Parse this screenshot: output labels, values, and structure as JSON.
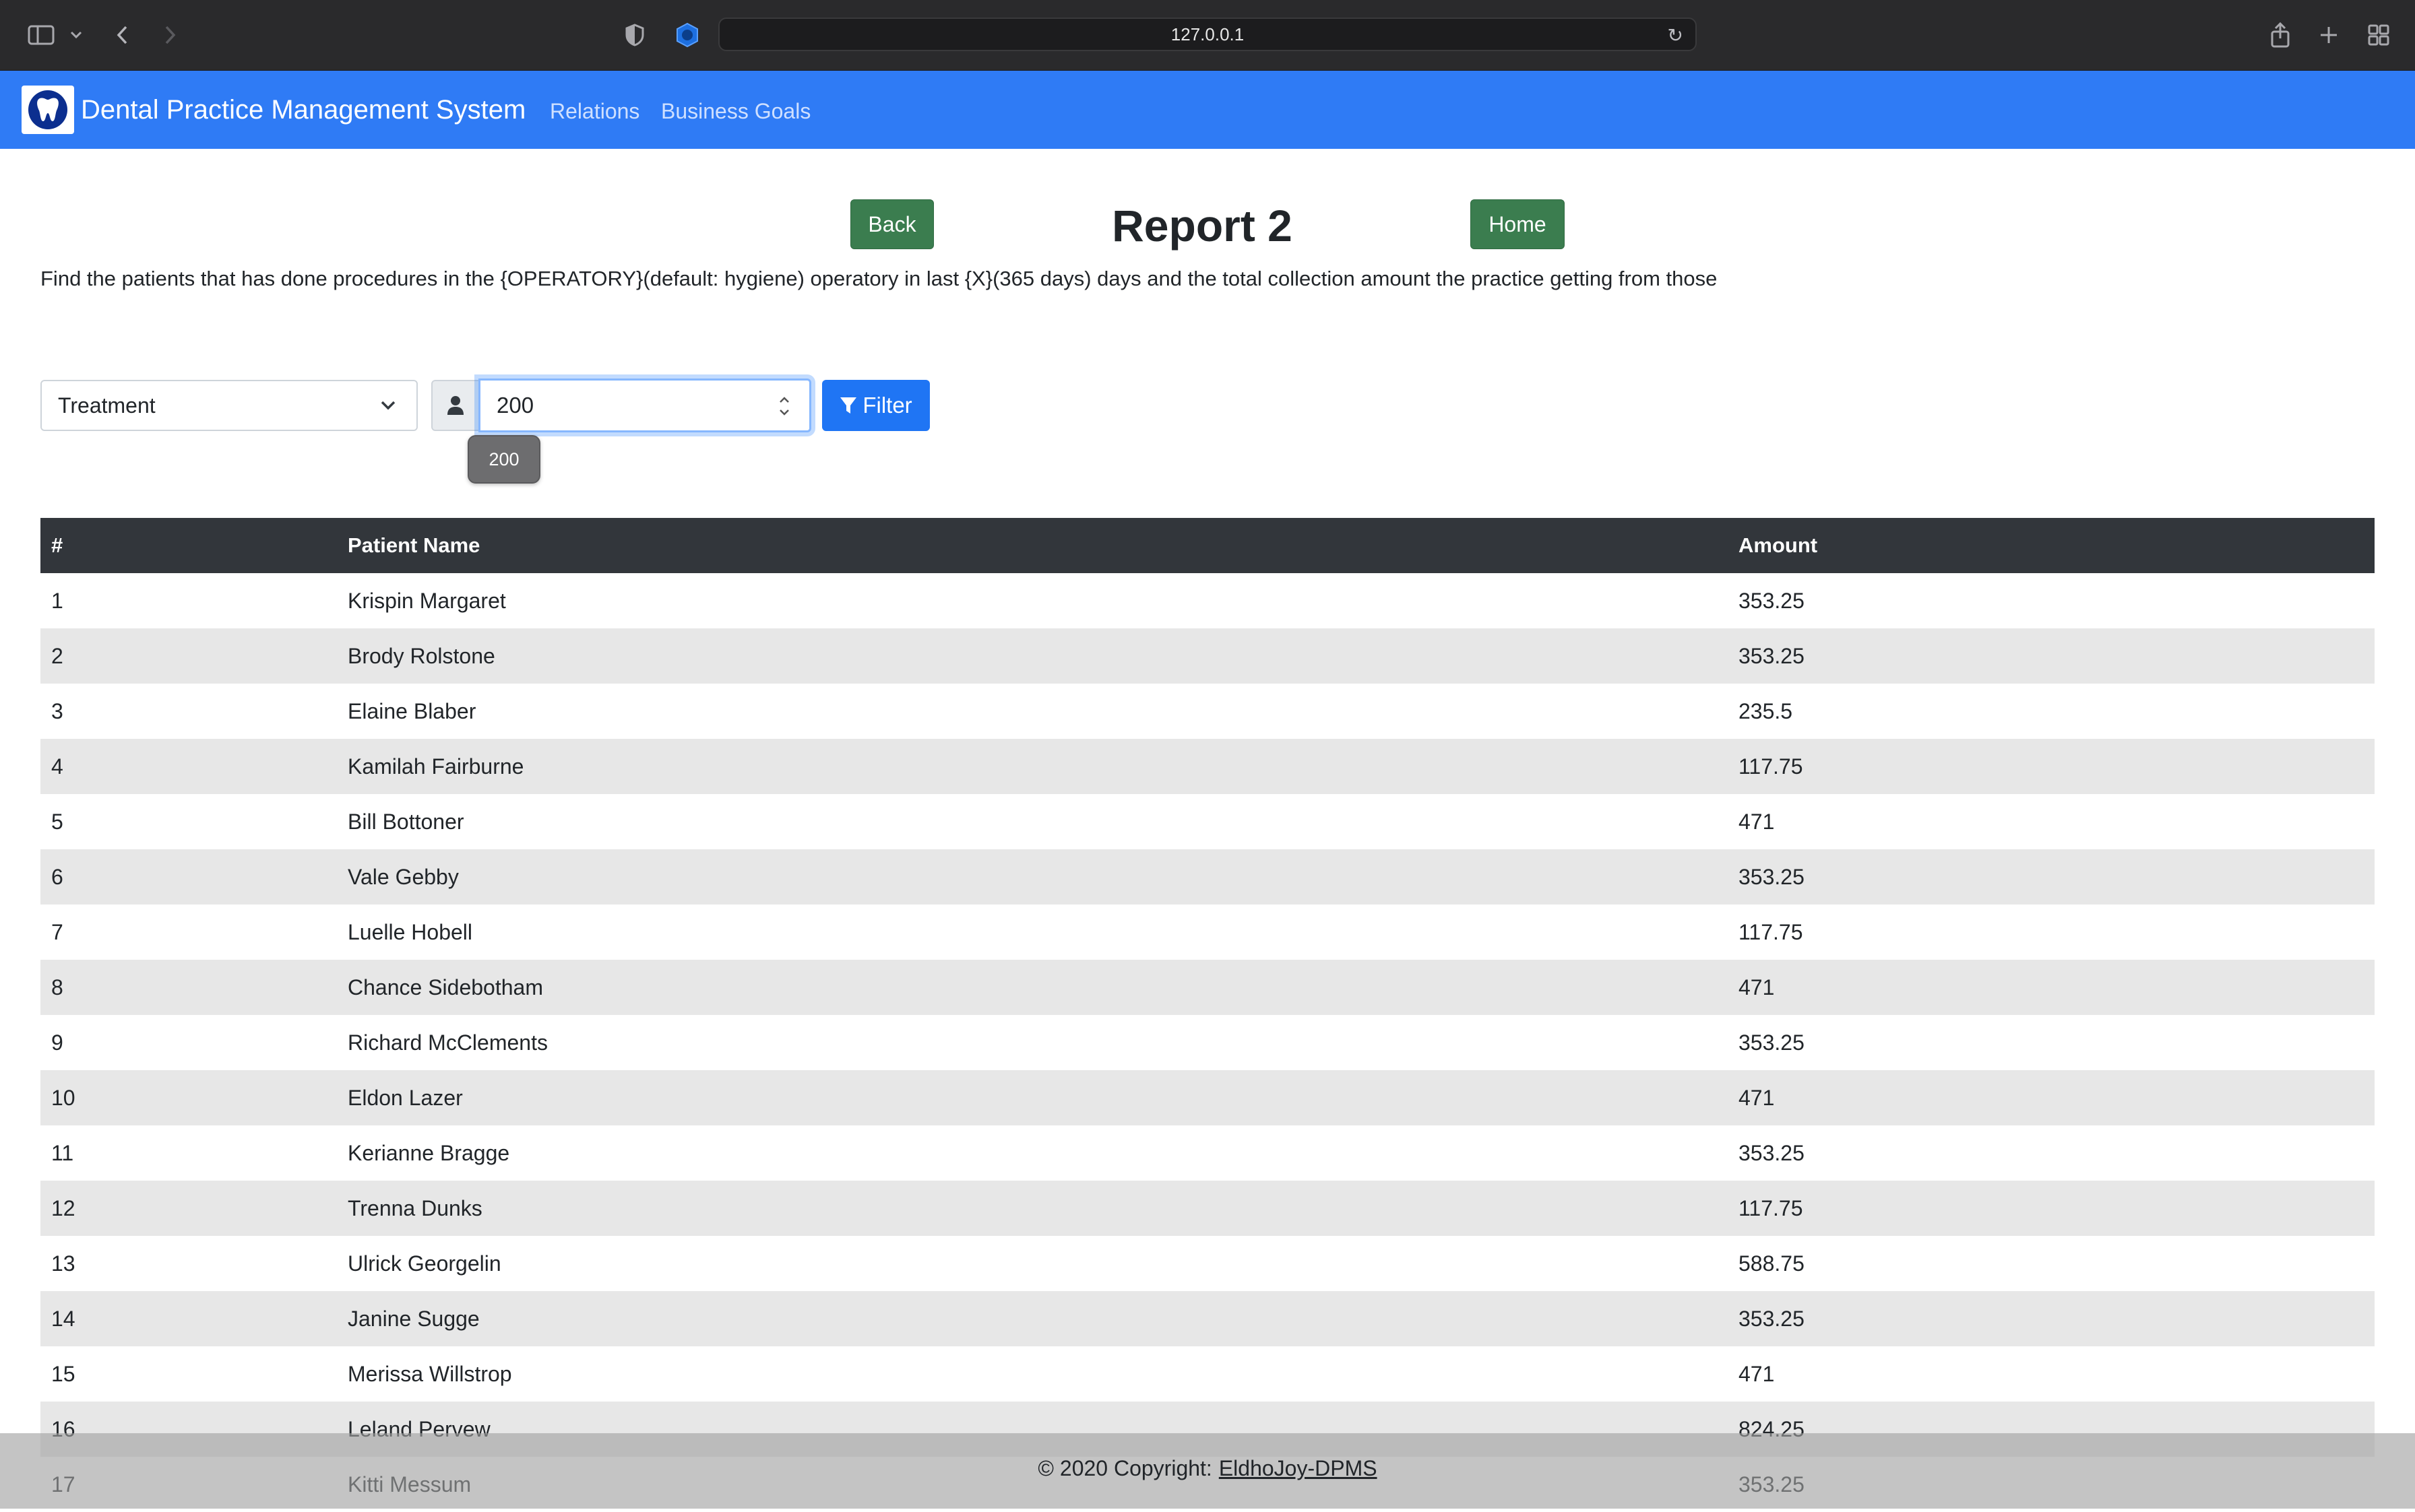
{
  "browser": {
    "url": "127.0.0.1"
  },
  "navbar": {
    "brand": "Dental Practice Management System",
    "links": [
      "Relations",
      "Business Goals"
    ]
  },
  "header": {
    "back_label": "Back",
    "title": "Report 2",
    "home_label": "Home",
    "description": "Find the patients that has done procedures in the {OPERATORY}(default: hygiene) operatory in last {X}(365 days) days and the total collection amount the practice getting from those"
  },
  "filter": {
    "select_value": "Treatment",
    "input_value": "200",
    "tooltip": "200",
    "button_label": "Filter"
  },
  "table": {
    "headers": [
      "#",
      "Patient Name",
      "Amount"
    ],
    "rows": [
      [
        "1",
        "Krispin Margaret",
        "353.25"
      ],
      [
        "2",
        "Brody Rolstone",
        "353.25"
      ],
      [
        "3",
        "Elaine Blaber",
        "235.5"
      ],
      [
        "4",
        "Kamilah Fairburne",
        "117.75"
      ],
      [
        "5",
        "Bill Bottoner",
        "471"
      ],
      [
        "6",
        "Vale Gebby",
        "353.25"
      ],
      [
        "7",
        "Luelle Hobell",
        "117.75"
      ],
      [
        "8",
        "Chance Sidebotham",
        "471"
      ],
      [
        "9",
        "Richard McClements",
        "353.25"
      ],
      [
        "10",
        "Eldon Lazer",
        "471"
      ],
      [
        "11",
        "Kerianne Bragge",
        "353.25"
      ],
      [
        "12",
        "Trenna Dunks",
        "117.75"
      ],
      [
        "13",
        "Ulrick Georgelin",
        "588.75"
      ],
      [
        "14",
        "Janine Sugge",
        "353.25"
      ],
      [
        "15",
        "Merissa Willstrop",
        "471"
      ],
      [
        "16",
        "Leland Pervew",
        "824.25"
      ],
      [
        "17",
        "Kitti Messum",
        "353.25"
      ]
    ]
  },
  "footer": {
    "copyright": "© 2020 Copyright:",
    "link": "EldhoJoy-DPMS"
  },
  "colors": {
    "navbar": "#2f7bf5",
    "green_button": "#3b7d4f",
    "primary_button": "#1f75f4",
    "table_header": "#32363b",
    "stripe": "#e7e7e7"
  },
  "icons": {
    "sidebar": "sidebar-icon",
    "back": "chevron-left-icon",
    "forward": "chevron-right-icon",
    "shield": "privacy-shield-icon",
    "reload": "reload-icon",
    "share": "share-icon",
    "new_tab": "plus-icon",
    "tabs": "grid-icon",
    "logo": "tooth-icon",
    "user": "user-icon",
    "filter": "funnel-icon"
  }
}
